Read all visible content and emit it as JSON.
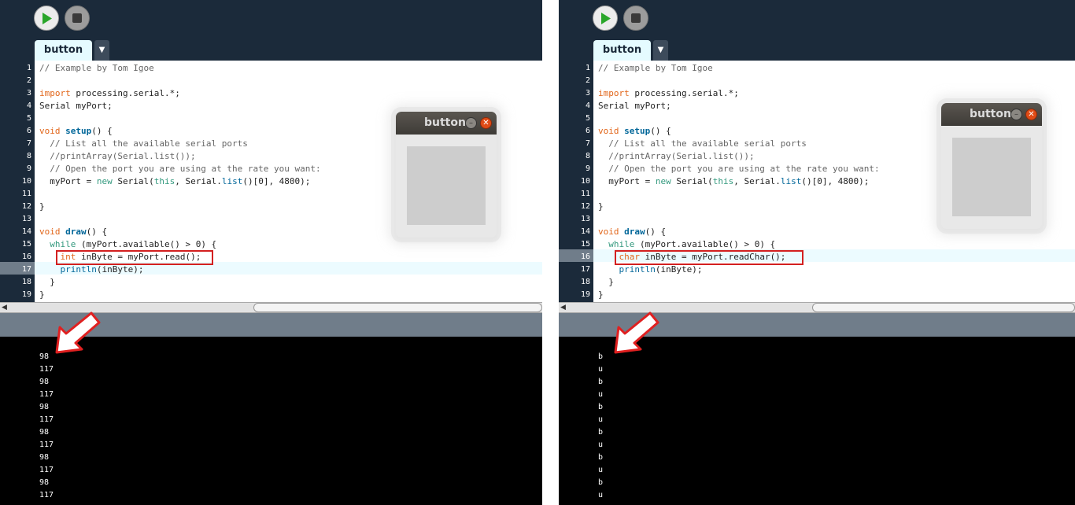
{
  "panels": [
    {
      "tab_label": "button",
      "tab_menu_glyph": "▼",
      "window_title": "button",
      "line_numbers": [
        "1",
        "2",
        "3",
        "4",
        "5",
        "6",
        "7",
        "8",
        "9",
        "10",
        "11",
        "12",
        "13",
        "14",
        "15",
        "16",
        "17",
        "18",
        "19"
      ],
      "highlighted_line": 17,
      "boxed_line": 16,
      "console_output": [
        "98",
        "117",
        "98",
        "117",
        "98",
        "117",
        "98",
        "117",
        "98",
        "117",
        "98",
        "117"
      ]
    },
    {
      "tab_label": "button",
      "tab_menu_glyph": "▼",
      "window_title": "button",
      "line_numbers": [
        "1",
        "2",
        "3",
        "4",
        "5",
        "6",
        "7",
        "8",
        "9",
        "10",
        "11",
        "12",
        "13",
        "14",
        "15",
        "16",
        "17",
        "18",
        "19"
      ],
      "highlighted_line": 16,
      "boxed_line": 16,
      "console_output": [
        "b",
        "u",
        "b",
        "u",
        "b",
        "u",
        "b",
        "u",
        "b",
        "u",
        "b",
        "u"
      ]
    }
  ],
  "code_common": {
    "l1": "// Example by Tom Igoe",
    "l3_kw": "import",
    "l3_rest": " processing.serial.*;",
    "l4": "Serial myPort;",
    "l6_kw": "void",
    "l6_fn": "setup",
    "l6_rest": "() {",
    "l7": "  // List all the available serial ports",
    "l8": "  //printArray(Serial.list());",
    "l9": "  // Open the port you are using at the rate you want:",
    "l10_a": "  myPort = ",
    "l10_new": "new",
    "l10_b": " Serial(",
    "l10_this": "this",
    "l10_c": ", Serial.",
    "l10_list": "list",
    "l10_d": "()[0], 4800);",
    "l12": "}",
    "l14_kw": "void",
    "l14_fn": "draw",
    "l14_rest": "() {",
    "l15_kw": "while",
    "l15_rest": " (myPort.available() > 0) {",
    "l17_fn": "println",
    "l17_rest": "(inByte);",
    "l18": "  }",
    "l19": "}"
  },
  "code_left_l16": {
    "type": "int",
    "rest": " inByte = myPort.read();"
  },
  "code_right_l16": {
    "type": "char",
    "rest": " inByte = myPort.readChar();"
  },
  "colors": {
    "toolbar": "#1b2a3a",
    "keyword": "#33997e",
    "type": "#e2661a",
    "function": "#006699",
    "highlight_box": "#d32020"
  }
}
